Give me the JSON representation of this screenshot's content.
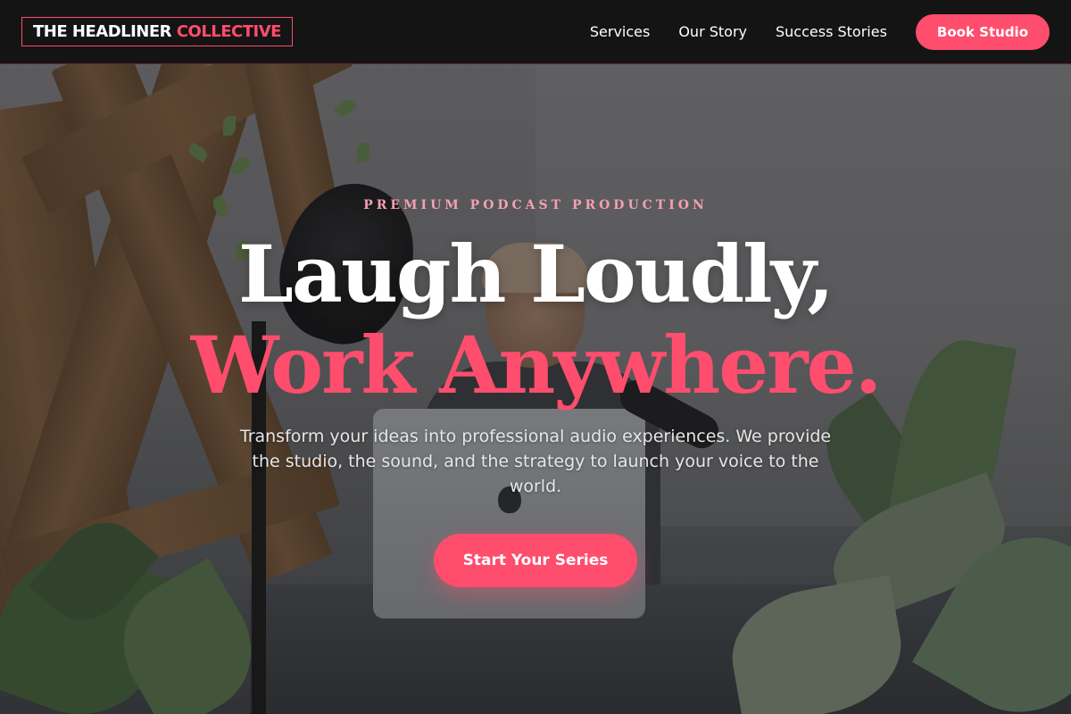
{
  "brand": {
    "name_main": "THE HEADLINER",
    "name_accent": "COLLECTIVE",
    "accent_color": "#ff4d6d"
  },
  "nav": {
    "links": [
      {
        "label": "Services"
      },
      {
        "label": "Our Story"
      },
      {
        "label": "Success Stories"
      }
    ],
    "cta_label": "Book Studio"
  },
  "hero": {
    "eyebrow": "PREMIUM PODCAST PRODUCTION",
    "headline_line1": "Laugh Loudly,",
    "headline_line2": "Work Anywhere.",
    "subtext": "Transform your ideas into professional audio experiences. We provide the studio, the sound, and the strategy to launch your voice to the world.",
    "cta_label": "Start Your Series",
    "background_description_icon": "podcast-studio-photo"
  },
  "colors": {
    "nav_background": "#141414",
    "primary": "#ff4d6d",
    "eyebrow": "#f3a0b0",
    "headline": "#ffffff",
    "body_text": "#e6e6e6"
  }
}
